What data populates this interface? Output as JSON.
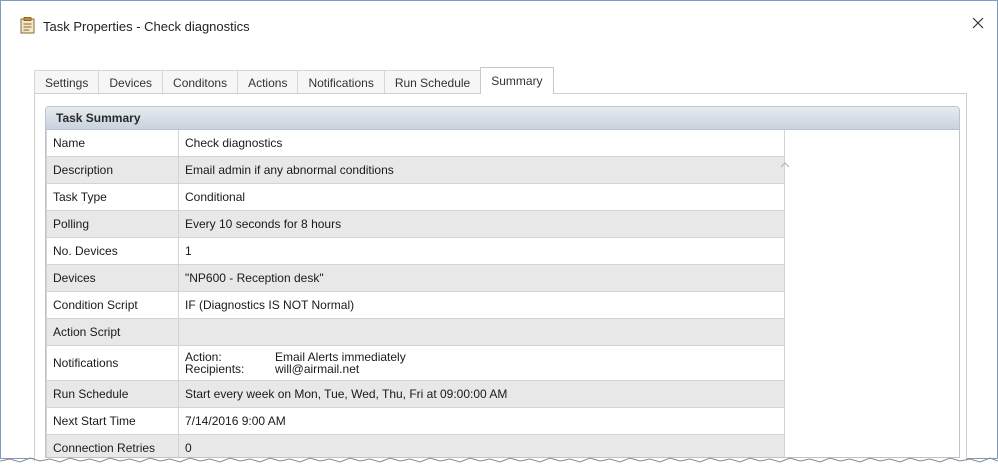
{
  "window": {
    "title": "Task Properties - Check diagnostics",
    "icon": "task-properties-icon",
    "close_icon": "close-icon"
  },
  "tabs": [
    {
      "label": "Settings",
      "active": false
    },
    {
      "label": "Devices",
      "active": false
    },
    {
      "label": "Conditons",
      "active": false
    },
    {
      "label": "Actions",
      "active": false
    },
    {
      "label": "Notifications",
      "active": false
    },
    {
      "label": "Run Schedule",
      "active": false
    },
    {
      "label": "Summary",
      "active": true
    }
  ],
  "summary": {
    "header": "Task Summary",
    "rows": {
      "name": {
        "label": "Name",
        "value": "Check diagnostics"
      },
      "description": {
        "label": "Description",
        "value": "Email admin if any abnormal conditions"
      },
      "task_type": {
        "label": "Task Type",
        "value": "Conditional"
      },
      "polling": {
        "label": "Polling",
        "value": "Every 10 seconds for 8 hours"
      },
      "no_devices": {
        "label": "No. Devices",
        "value": "1"
      },
      "devices": {
        "label": "Devices",
        "value": "\"NP600 - Reception desk\""
      },
      "condition_script": {
        "label": "Condition Script",
        "value": "IF (Diagnostics IS NOT Normal)"
      },
      "action_script": {
        "label": "Action Script",
        "value": ""
      },
      "notifications": {
        "label": "Notifications",
        "action_label": "Action:",
        "action_value": "Email Alerts immediately",
        "recipients_label": "Recipients:",
        "recipients_value": "will@airmail.net"
      },
      "run_schedule": {
        "label": "Run Schedule",
        "value": "Start every week on Mon, Tue, Wed, Thu, Fri at 09:00:00 AM"
      },
      "next_start_time": {
        "label": "Next Start Time",
        "value": "7/14/2016 9:00 AM"
      },
      "connection_retries": {
        "label": "Connection Retries",
        "value": "0"
      }
    }
  },
  "colors": {
    "border_accent": "#7a9cc6",
    "header_gradient_top": "#e6ebf0",
    "header_gradient_bottom": "#c9d2dc",
    "alt_row": "#e8e8e8"
  }
}
